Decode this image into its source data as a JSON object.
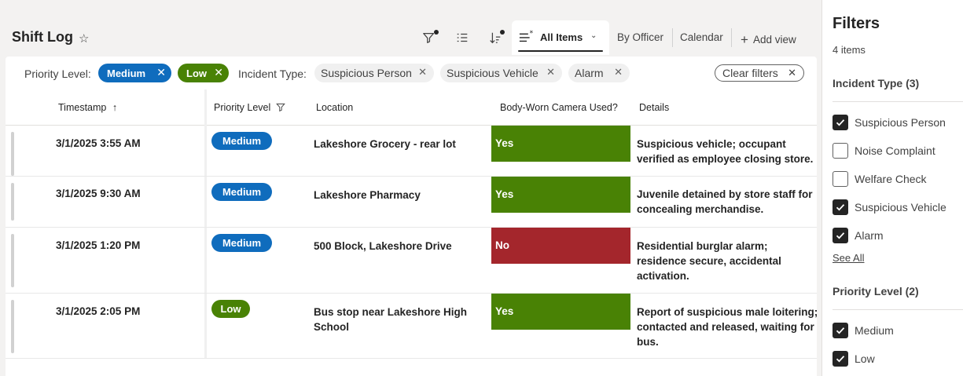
{
  "header": {
    "title": "Shift Log",
    "tabs": [
      {
        "label": "All Items"
      },
      {
        "label": "By Officer"
      },
      {
        "label": "Calendar"
      }
    ],
    "add_view": "Add view"
  },
  "filters_bar": {
    "priority_label": "Priority Level:",
    "priority_pills": [
      {
        "label": "Medium",
        "color": "#0f6cbd"
      },
      {
        "label": "Low",
        "color": "#498205"
      }
    ],
    "incident_label": "Incident Type:",
    "incident_chips": [
      {
        "label": "Suspicious Person"
      },
      {
        "label": "Suspicious Vehicle"
      },
      {
        "label": "Alarm"
      }
    ],
    "clear_label": "Clear filters"
  },
  "table": {
    "columns": [
      "Timestamp",
      "Priority Level",
      "Location",
      "Body-Worn Camera Used?",
      "Details"
    ],
    "rows": [
      {
        "timestamp": "3/1/2025 3:55 AM",
        "priority": "Medium",
        "location": "Lakeshore Grocery - rear lot",
        "camera": "Yes",
        "details": "Suspicious vehicle; occupant verified as employee closing store."
      },
      {
        "timestamp": "3/1/2025 9:30 AM",
        "priority": "Medium",
        "location": "Lakeshore Pharmacy",
        "camera": "Yes",
        "details": "Juvenile detained by store staff for concealing merchandise."
      },
      {
        "timestamp": "3/1/2025 1:20 PM",
        "priority": "Medium",
        "location": "500 Block, Lakeshore Drive",
        "camera": "No",
        "details": "Residential burglar alarm; residence secure, accidental activation."
      },
      {
        "timestamp": "3/1/2025 2:05 PM",
        "priority": "Low",
        "location": "Bus stop near Lakeshore High School",
        "camera": "Yes",
        "details": "Report of suspicious male loitering; contacted and released, waiting for bus."
      }
    ]
  },
  "colors": {
    "medium": "#0f6cbd",
    "low": "#498205",
    "yes": "#498205",
    "no": "#a4262c"
  },
  "panel": {
    "title": "Filters",
    "count": "4 items",
    "incident_section": "Incident Type (3)",
    "incident_options": [
      {
        "label": "Suspicious Person",
        "checked": true
      },
      {
        "label": "Noise Complaint",
        "checked": false
      },
      {
        "label": "Welfare Check",
        "checked": false
      },
      {
        "label": "Suspicious Vehicle",
        "checked": true
      },
      {
        "label": "Alarm",
        "checked": true
      }
    ],
    "see_all": "See All",
    "priority_section": "Priority Level (2)",
    "priority_options": [
      {
        "label": "Medium",
        "checked": true
      },
      {
        "label": "Low",
        "checked": true
      }
    ]
  }
}
